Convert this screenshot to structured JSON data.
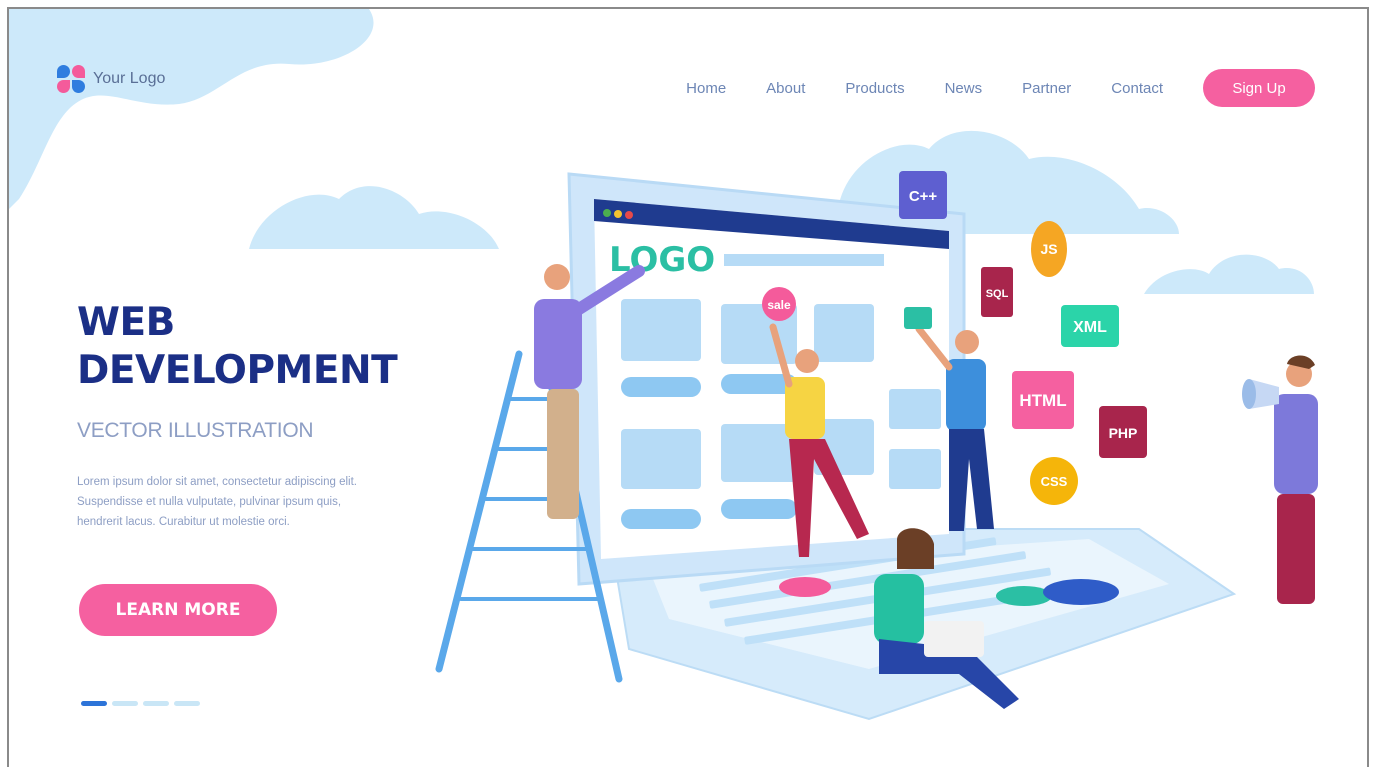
{
  "header": {
    "logo_text": "Your Logo",
    "nav": [
      "Home",
      "About",
      "Products",
      "News",
      "Partner",
      "Contact"
    ],
    "signup_label": "Sign Up"
  },
  "hero": {
    "title_line1": "WEB",
    "title_line2": "DEVELOPMENT",
    "subtitle": "VECTOR ILLUSTRATION",
    "body": "Lorem ipsum dolor sit amet, consectetur adipiscing elit. Suspendisse et nulla vulputate, pulvinar ipsum quis, hendrerit lacus. Curabitur ut molestie orci.",
    "cta_label": "LEARN MORE"
  },
  "carousel": {
    "count": 4,
    "active": 0
  },
  "illustration": {
    "site_logo": "LOGO",
    "sale_tag": "sale",
    "tags": [
      "C++",
      "JS",
      "SQL",
      "XML",
      "HTML",
      "PHP",
      "CSS"
    ]
  },
  "colors": {
    "brand_navy": "#1b2f86",
    "accent_pink": "#f560a0",
    "cloud_blue": "#cde9fa",
    "muted_text": "#8d9ec4",
    "nav_text": "#6d86b5"
  }
}
